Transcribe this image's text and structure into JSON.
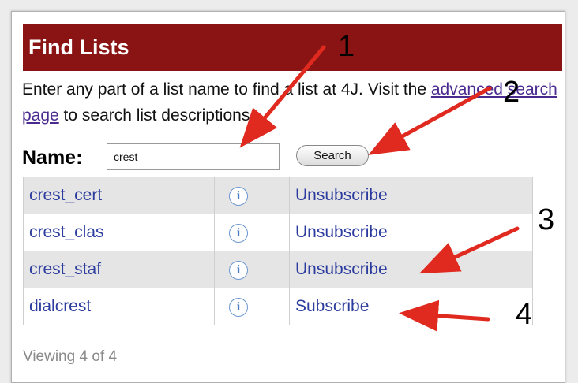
{
  "panel": {
    "title": "Find Lists",
    "intro_before": "Enter any part of a list name to find a list at 4J. Visit the ",
    "intro_link": "advanced search page",
    "intro_after": " to search list descriptions."
  },
  "search": {
    "label": "Name:",
    "value": "crest",
    "button_label": "Search"
  },
  "results": [
    {
      "name": "crest_cert",
      "info_icon": "info-icon",
      "action": "Unsubscribe"
    },
    {
      "name": "crest_clas",
      "info_icon": "info-icon",
      "action": "Unsubscribe"
    },
    {
      "name": "crest_staf",
      "info_icon": "info-icon",
      "action": "Unsubscribe"
    },
    {
      "name": "dialcrest",
      "info_icon": "info-icon",
      "action": "Subscribe"
    }
  ],
  "footer": {
    "viewing": "Viewing 4 of 4"
  },
  "annotations": {
    "callouts": [
      "1",
      "2",
      "3",
      "4"
    ],
    "arrow_color": "#e02a1f"
  },
  "colors": {
    "header_bg": "#8a1414",
    "link": "#2c3c9e",
    "row_alt": "#e5e5e5"
  }
}
